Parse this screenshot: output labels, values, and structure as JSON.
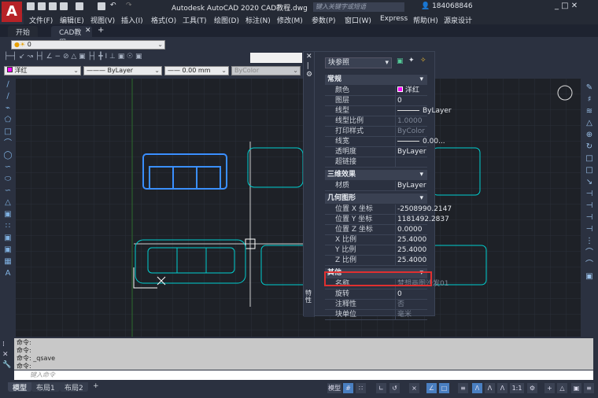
{
  "app": {
    "title": "Autodesk AutoCAD 2020    CAD教程.dwg",
    "search_placeholder": "键入关键字或短语",
    "user": "184068846",
    "logo": "A"
  },
  "menu": [
    "文件(F)",
    "编辑(E)",
    "视图(V)",
    "插入(I)",
    "格式(O)",
    "工具(T)",
    "绘图(D)",
    "标注(N)",
    "修改(M)",
    "参数(P)",
    "窗口(W)",
    "Express",
    "帮助(H)",
    "源泉设计"
  ],
  "tabs": [
    {
      "label": "开始"
    },
    {
      "label": "CAD教程",
      "active": true
    }
  ],
  "toolbar": {
    "layer": "0",
    "color": "洋红",
    "linetype": "ByLayer",
    "lineweight": "0.00 mm",
    "plotstyle": "ByColor"
  },
  "palette": {
    "selector": "块参照",
    "side_label": "特性",
    "sections": [
      {
        "title": "常规",
        "rows": [
          {
            "k": "颜色",
            "v": "洋红",
            "swatch": "#ff00ff"
          },
          {
            "k": "图层",
            "v": "0"
          },
          {
            "k": "线型",
            "v": "ByLayer",
            "line": true
          },
          {
            "k": "线型比例",
            "v": "1.0000",
            "dim": true
          },
          {
            "k": "打印样式",
            "v": "ByColor",
            "dim": true
          },
          {
            "k": "线宽",
            "v": "0.00...",
            "line": true
          },
          {
            "k": "透明度",
            "v": "ByLayer"
          },
          {
            "k": "超链接",
            "v": ""
          }
        ]
      },
      {
        "title": "三维效果",
        "rows": [
          {
            "k": "材质",
            "v": "ByLayer"
          }
        ]
      },
      {
        "title": "几何图形",
        "rows": [
          {
            "k": "位置 X 坐标",
            "v": "-2508990.2147"
          },
          {
            "k": "位置 Y 坐标",
            "v": "1181492.2837"
          },
          {
            "k": "位置 Z 坐标",
            "v": "0.0000"
          },
          {
            "k": "X 比例",
            "v": "25.4000"
          },
          {
            "k": "Y 比例",
            "v": "25.4000"
          },
          {
            "k": "Z 比例",
            "v": "25.4000"
          }
        ]
      },
      {
        "title": "其他",
        "rows": [
          {
            "k": "名称",
            "v": "梦想画图沙发01",
            "dim": true
          },
          {
            "k": "旋转",
            "v": "0"
          },
          {
            "k": "注释性",
            "v": "否",
            "dim": true
          },
          {
            "k": "块单位",
            "v": "毫米",
            "dim": true
          }
        ]
      }
    ]
  },
  "command": {
    "history": [
      "命令:",
      "命令:",
      "命令: _qsave",
      "命令:"
    ],
    "placeholder": "键入命令"
  },
  "layouts": [
    "模型",
    "布局1",
    "布局2",
    "+"
  ],
  "status": {
    "model": "模型",
    "scale": "1:1"
  },
  "colors": {
    "accent": "#4a7fc1",
    "highlight": "#e03030",
    "cyan": "#00d0d0",
    "blue": "#3a8fff"
  }
}
